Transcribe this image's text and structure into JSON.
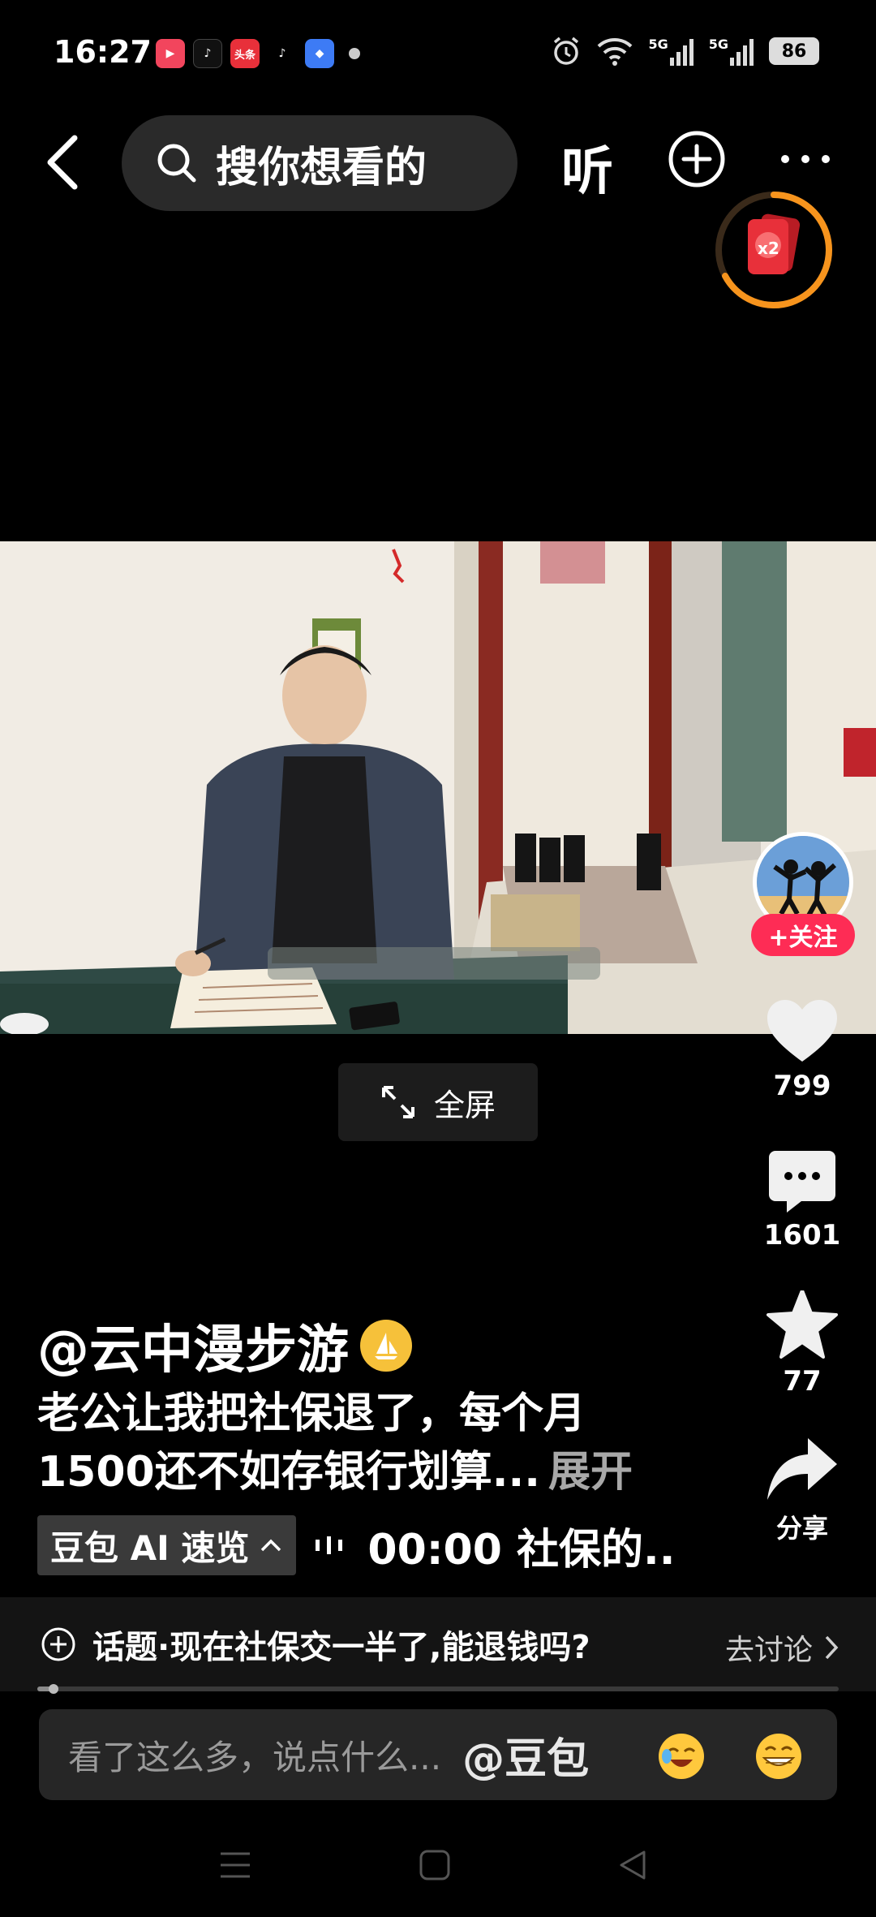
{
  "status_bar": {
    "time": "16:27",
    "app_icons": [
      "video-app-icon",
      "douyin-icon",
      "toutiao-icon",
      "tiktok-icon",
      "blue-app-icon"
    ],
    "toutiao_label": "头条",
    "signal_1": "5G",
    "signal_2": "5G",
    "battery": "86"
  },
  "nav": {
    "search_placeholder": "搜你想看的",
    "listen_label": "听"
  },
  "redpacket": {
    "badge": "x2"
  },
  "video": {
    "fullscreen_label": "全屏"
  },
  "rail": {
    "follow_label": "+关注",
    "likes": "799",
    "comments": "1601",
    "favorites": "77",
    "share_label": "分享"
  },
  "caption": {
    "author": "@云中漫步游",
    "line1": "老公让我把社保退了，每个月",
    "line2": "1500还不如存银行划算...",
    "expand": "展开"
  },
  "ai": {
    "chip_label": "豆包 AI 速览",
    "time_text": "00:00 社保的.."
  },
  "topic": {
    "text": "话题·现在社保交一半了,能退钱吗?",
    "action": "去讨论"
  },
  "progress": {
    "fraction": 0.02
  },
  "comment": {
    "placeholder": "看了这么多，说点什么...",
    "mention": "@豆包"
  },
  "colors": {
    "follow": "#fe2c55",
    "redpacket_ring": "#f7941d",
    "redpacket": "#e8303a",
    "verified": "#f6c13a"
  }
}
